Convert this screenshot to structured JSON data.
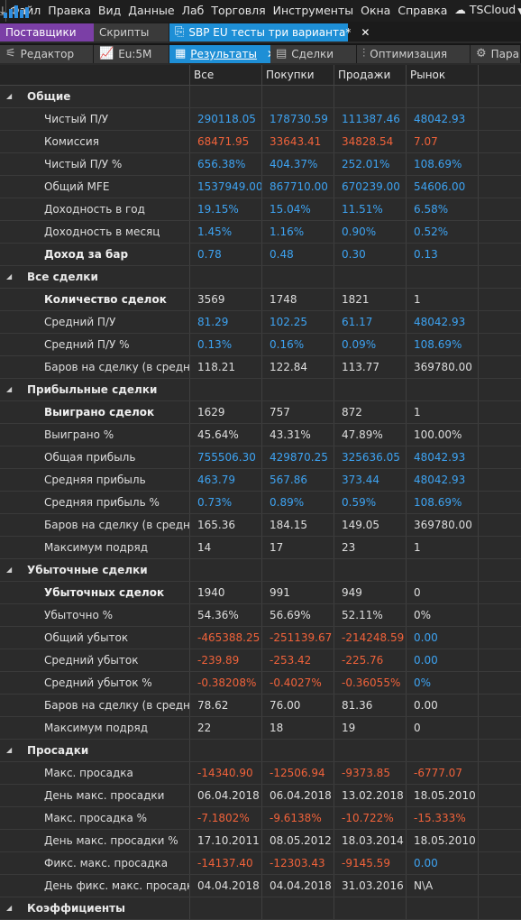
{
  "menubar": {
    "items": [
      "Файл",
      "Правка",
      "Вид",
      "Данные",
      "Лаб",
      "Торговля",
      "Инструменты",
      "Окна",
      "Справка"
    ],
    "cloud_label": "TSCloud"
  },
  "tabs_row1": [
    {
      "label": "Поставщики",
      "style": "purple"
    },
    {
      "label": "Скрипты",
      "style": "dark"
    },
    {
      "label": "SBP EU тесты три варианта*",
      "style": "active",
      "close": "✕"
    }
  ],
  "tabs_row2": [
    {
      "label": "Редактор",
      "icon": "editor-icon"
    },
    {
      "label": "Eu:5M",
      "icon": "chart-icon"
    },
    {
      "label": "Результаты",
      "icon": "results-icon",
      "active": true,
      "close": "✕"
    },
    {
      "label": "Сделки",
      "icon": "trades-icon"
    },
    {
      "label": "Оптимизация",
      "icon": "optimization-icon"
    },
    {
      "label": "Пара",
      "icon": "gear-icon"
    }
  ],
  "columns": [
    "",
    "Все",
    "Покупки",
    "Продажи",
    "Рынок"
  ],
  "colors": {
    "positive": "#3da3f2",
    "negative": "#f0623a",
    "neutral": "#dedede",
    "accent": "#1e8fd6"
  },
  "rows": [
    {
      "type": "group",
      "label": "Общие"
    },
    {
      "type": "item",
      "label": "Чистый П/У",
      "values": [
        "290118.05",
        "178730.59",
        "111387.46",
        "48042.93"
      ],
      "colors": [
        "blue",
        "blue",
        "blue",
        "blue"
      ]
    },
    {
      "type": "item",
      "label": "Комиссия",
      "values": [
        "68471.95",
        "33643.41",
        "34828.54",
        "7.07"
      ],
      "colors": [
        "red",
        "red",
        "red",
        "red"
      ]
    },
    {
      "type": "item",
      "label": "Чистый П/У %",
      "values": [
        "656.38%",
        "404.37%",
        "252.01%",
        "108.69%"
      ],
      "colors": [
        "blue",
        "blue",
        "blue",
        "blue"
      ]
    },
    {
      "type": "item",
      "label": "Общий MFE",
      "values": [
        "1537949.00",
        "867710.00",
        "670239.00",
        "54606.00"
      ],
      "colors": [
        "blue",
        "blue",
        "blue",
        "blue"
      ]
    },
    {
      "type": "item",
      "label": "Доходность в год",
      "values": [
        "19.15%",
        "15.04%",
        "11.51%",
        "6.58%"
      ],
      "colors": [
        "blue",
        "blue",
        "blue",
        "blue"
      ]
    },
    {
      "type": "item",
      "label": "Доходность в месяц",
      "values": [
        "1.45%",
        "1.16%",
        "0.90%",
        "0.52%"
      ],
      "colors": [
        "blue",
        "blue",
        "blue",
        "blue"
      ]
    },
    {
      "type": "item",
      "bold": true,
      "label": "Доход за бар",
      "values": [
        "0.78",
        "0.48",
        "0.30",
        "0.13"
      ],
      "colors": [
        "blue",
        "blue",
        "blue",
        "blue"
      ]
    },
    {
      "type": "group",
      "label": "Все сделки"
    },
    {
      "type": "item",
      "bold": true,
      "label": "Количество сделок",
      "values": [
        "3569",
        "1748",
        "1821",
        "1"
      ],
      "colors": [
        "white",
        "white",
        "white",
        "white"
      ]
    },
    {
      "type": "item",
      "label": "Средний П/У",
      "values": [
        "81.29",
        "102.25",
        "61.17",
        "48042.93"
      ],
      "colors": [
        "blue",
        "blue",
        "blue",
        "blue"
      ]
    },
    {
      "type": "item",
      "label": "Средний П/У %",
      "values": [
        "0.13%",
        "0.16%",
        "0.09%",
        "108.69%"
      ],
      "colors": [
        "blue",
        "blue",
        "blue",
        "blue"
      ]
    },
    {
      "type": "item",
      "label": "Баров на сделку (в среднем)",
      "values": [
        "118.21",
        "122.84",
        "113.77",
        "369780.00"
      ],
      "colors": [
        "white",
        "white",
        "white",
        "white"
      ]
    },
    {
      "type": "group",
      "label": "Прибыльные сделки"
    },
    {
      "type": "item",
      "bold": true,
      "label": "Выиграно сделок",
      "values": [
        "1629",
        "757",
        "872",
        "1"
      ],
      "colors": [
        "white",
        "white",
        "white",
        "white"
      ]
    },
    {
      "type": "item",
      "label": "Выиграно %",
      "values": [
        "45.64%",
        "43.31%",
        "47.89%",
        "100.00%"
      ],
      "colors": [
        "white",
        "white",
        "white",
        "white"
      ]
    },
    {
      "type": "item",
      "label": "Общая прибыль",
      "values": [
        "755506.30",
        "429870.25",
        "325636.05",
        "48042.93"
      ],
      "colors": [
        "blue",
        "blue",
        "blue",
        "blue"
      ]
    },
    {
      "type": "item",
      "label": "Средняя прибыль",
      "values": [
        "463.79",
        "567.86",
        "373.44",
        "48042.93"
      ],
      "colors": [
        "blue",
        "blue",
        "blue",
        "blue"
      ]
    },
    {
      "type": "item",
      "label": "Средняя прибыль %",
      "values": [
        "0.73%",
        "0.89%",
        "0.59%",
        "108.69%"
      ],
      "colors": [
        "blue",
        "blue",
        "blue",
        "blue"
      ]
    },
    {
      "type": "item",
      "label": "Баров на сделку (в среднем)",
      "values": [
        "165.36",
        "184.15",
        "149.05",
        "369780.00"
      ],
      "colors": [
        "white",
        "white",
        "white",
        "white"
      ]
    },
    {
      "type": "item",
      "label": "Максимум подряд",
      "values": [
        "14",
        "17",
        "23",
        "1"
      ],
      "colors": [
        "white",
        "white",
        "white",
        "white"
      ]
    },
    {
      "type": "group",
      "label": "Убыточные сделки"
    },
    {
      "type": "item",
      "bold": true,
      "label": "Убыточных сделок",
      "values": [
        "1940",
        "991",
        "949",
        "0"
      ],
      "colors": [
        "white",
        "white",
        "white",
        "white"
      ]
    },
    {
      "type": "item",
      "label": "Убыточно %",
      "values": [
        "54.36%",
        "56.69%",
        "52.11%",
        "0%"
      ],
      "colors": [
        "white",
        "white",
        "white",
        "white"
      ]
    },
    {
      "type": "item",
      "label": "Общий убыток",
      "values": [
        "-465388.25",
        "-251139.67",
        "-214248.59",
        "0.00"
      ],
      "colors": [
        "red",
        "red",
        "red",
        "blue"
      ]
    },
    {
      "type": "item",
      "label": "Средний убыток",
      "values": [
        "-239.89",
        "-253.42",
        "-225.76",
        "0.00"
      ],
      "colors": [
        "red",
        "red",
        "red",
        "blue"
      ]
    },
    {
      "type": "item",
      "label": "Средний убыток %",
      "values": [
        "-0.38208%",
        "-0.4027%",
        "-0.36055%",
        "0%"
      ],
      "colors": [
        "red",
        "red",
        "red",
        "blue"
      ]
    },
    {
      "type": "item",
      "label": "Баров на сделку (в среднем)",
      "values": [
        "78.62",
        "76.00",
        "81.36",
        "0.00"
      ],
      "colors": [
        "white",
        "white",
        "white",
        "white"
      ]
    },
    {
      "type": "item",
      "label": "Максимум подряд",
      "values": [
        "22",
        "18",
        "19",
        "0"
      ],
      "colors": [
        "white",
        "white",
        "white",
        "white"
      ]
    },
    {
      "type": "group",
      "label": "Просадки"
    },
    {
      "type": "item",
      "label": "Макс. просадка",
      "values": [
        "-14340.90",
        "-12506.94",
        "-9373.85",
        "-6777.07"
      ],
      "colors": [
        "red",
        "red",
        "red",
        "red"
      ]
    },
    {
      "type": "item",
      "label": "День макс. просадки",
      "values": [
        "06.04.2018",
        "06.04.2018",
        "13.02.2018",
        "18.05.2010"
      ],
      "colors": [
        "white",
        "white",
        "white",
        "white"
      ]
    },
    {
      "type": "item",
      "label": "Макс. просадка %",
      "values": [
        "-7.1802%",
        "-9.6138%",
        "-10.722%",
        "-15.333%"
      ],
      "colors": [
        "red",
        "red",
        "red",
        "red"
      ]
    },
    {
      "type": "item",
      "label": "День макс. просадки %",
      "values": [
        "17.10.2011",
        "08.05.2012",
        "18.03.2014",
        "18.05.2010"
      ],
      "colors": [
        "white",
        "white",
        "white",
        "white"
      ]
    },
    {
      "type": "item",
      "label": "Фикс. макс. просадка",
      "values": [
        "-14137.40",
        "-12303.43",
        "-9145.59",
        "0.00"
      ],
      "colors": [
        "red",
        "red",
        "red",
        "blue"
      ]
    },
    {
      "type": "item",
      "label": "День фикс. макс. просадки",
      "values": [
        "04.04.2018",
        "04.04.2018",
        "31.03.2016",
        "N\\A"
      ],
      "colors": [
        "white",
        "white",
        "white",
        "white"
      ]
    },
    {
      "type": "group",
      "label": "Коэффициенты"
    }
  ]
}
